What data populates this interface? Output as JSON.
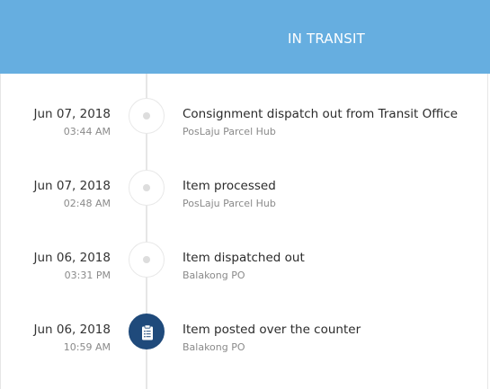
{
  "header": {
    "title": "IN TRANSIT"
  },
  "events": [
    {
      "date": "Jun 07, 2018",
      "time": "03:44 AM",
      "title": "Consignment dispatch out from Transit Office",
      "location": "PosLaju Parcel Hub"
    },
    {
      "date": "Jun 07, 2018",
      "time": "02:48 AM",
      "title": "Item processed",
      "location": "PosLaju Parcel Hub"
    },
    {
      "date": "Jun 06, 2018",
      "time": "03:31 PM",
      "title": "Item dispatched out",
      "location": "Balakong PO"
    },
    {
      "date": "Jun 06, 2018",
      "time": "10:59 AM",
      "title": "Item posted over the counter",
      "location": "Balakong PO"
    }
  ],
  "colors": {
    "header_bg": "#66aee0",
    "active_marker": "#1f4a7b"
  },
  "icons": {
    "active_marker": "clipboard-icon"
  }
}
